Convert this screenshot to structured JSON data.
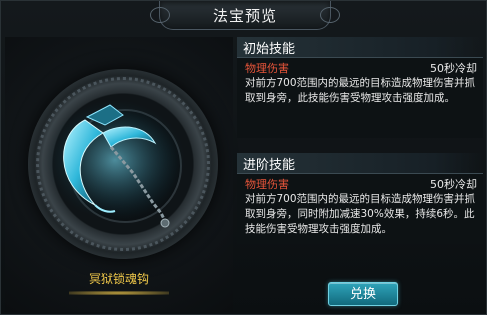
{
  "window": {
    "title": "法宝预览"
  },
  "item": {
    "name": "冥狱锁魂钩"
  },
  "initial_skill": {
    "heading": "初始技能",
    "type": "物理伤害",
    "cooldown": "50秒冷却",
    "description": "对前方700范围内的最远的目标造成物理伤害并抓取到身旁，此技能伤害受物理攻击强度加成。"
  },
  "advanced_skill": {
    "heading": "进阶技能",
    "type": "物理伤害",
    "cooldown": "50秒冷却",
    "description": "对前方700范围内的最远的目标造成物理伤害并抓取到身旁，同时附加减速30%效果，持续6秒。此技能伤害受物理攻击强度加成。"
  },
  "actions": {
    "switch_label": "兑换"
  },
  "colors": {
    "item_name": "#f0c84a",
    "damage_type": "#e8553a",
    "button": "#1f8aa0"
  },
  "icons": {
    "weapon": "soul-hook-icon"
  }
}
